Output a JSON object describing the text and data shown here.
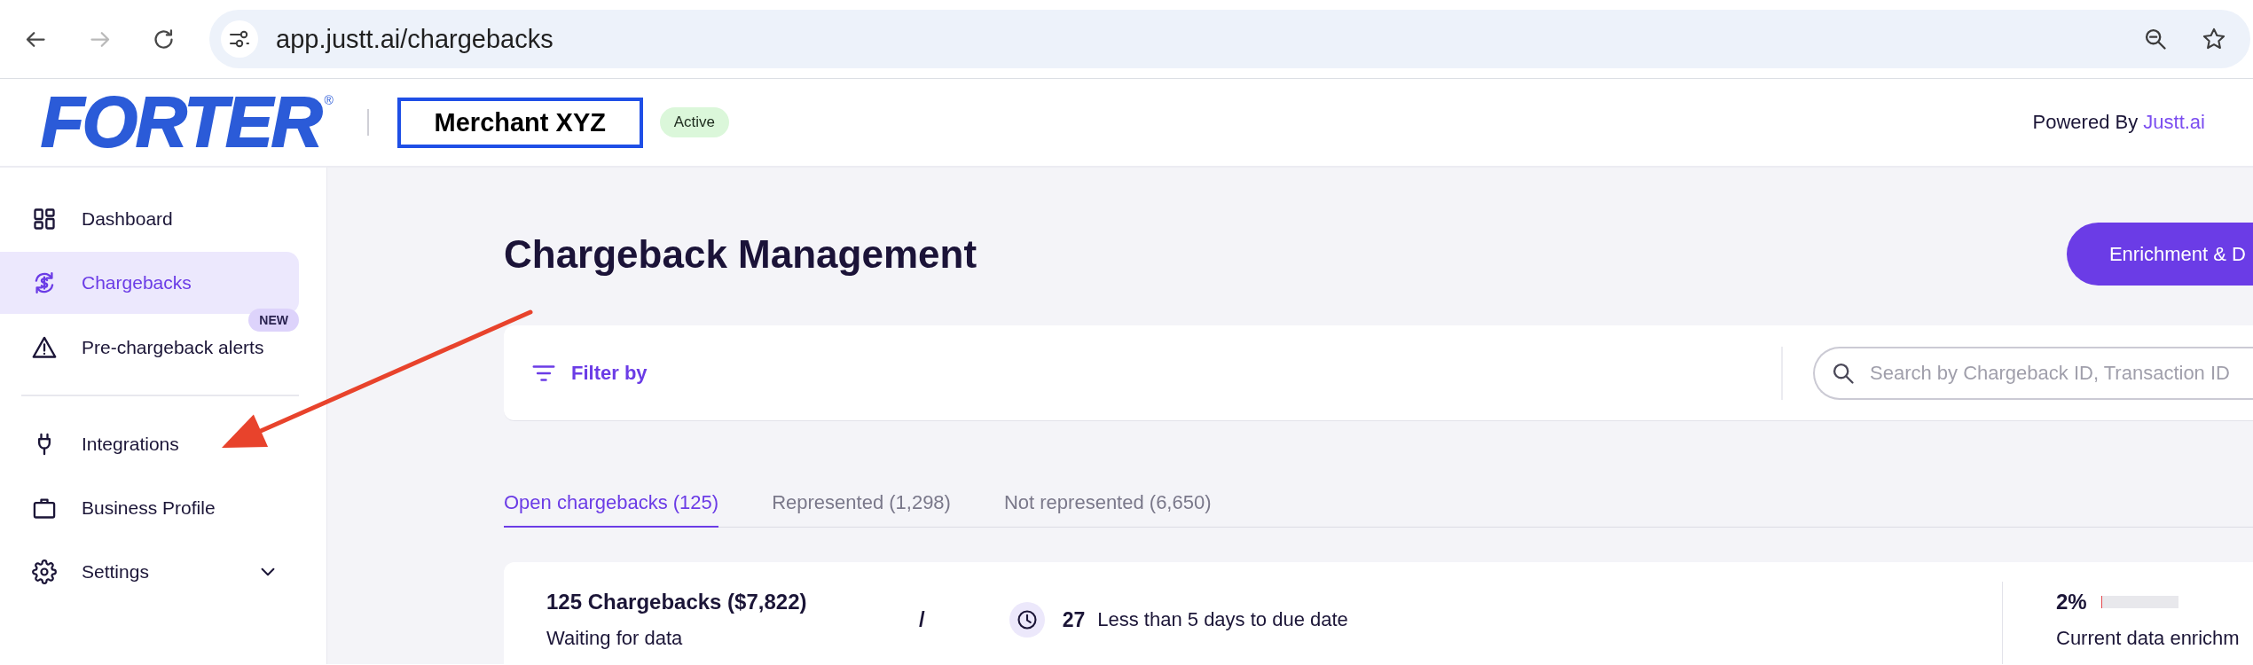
{
  "browser": {
    "nav": [
      {
        "disabled": false
      },
      {
        "disabled": true
      },
      {
        "disabled": false
      }
    ],
    "url": "app.justt.ai/chargebacks"
  },
  "header": {
    "logo": "FORTER",
    "logo_mark": "®",
    "merchant": "Merchant XYZ",
    "status": "Active",
    "powered_by": "Powered By",
    "powered_by_link": "Justt.ai"
  },
  "sidebar": {
    "groups": [
      {
        "items": [
          {
            "label": "Dashboard",
            "selected": false
          },
          {
            "label": "Chargebacks",
            "selected": true
          },
          {
            "label": "Pre-chargeback alerts",
            "selected": false,
            "badge": "NEW"
          }
        ]
      },
      {
        "items": [
          {
            "label": "Integrations",
            "selected": false
          },
          {
            "label": "Business Profile",
            "selected": false
          },
          {
            "label": "Settings",
            "selected": false,
            "expanded": false
          }
        ]
      }
    ]
  },
  "page": {
    "title": "Chargeback Management",
    "action_button": "Enrichment & D"
  },
  "filter_bar": {
    "filter_button": "Filter by",
    "search": {
      "placeholder": "Search by Chargeback ID, Transaction ID"
    }
  },
  "tabs": [
    {
      "label": "Open chargebacks (125)",
      "selected": true
    },
    {
      "label": "Represented (1,298)",
      "selected": false
    },
    {
      "label": "Not represented (6,650)",
      "selected": false
    }
  ],
  "summary": {
    "total": "125 Chargebacks ($7,822)",
    "total_caption": "Waiting for data",
    "separator": "/",
    "due_count": "27",
    "due_caption": "Less than 5 days to due date",
    "enrichment_percent": "2%",
    "enrichment": {
      "level": 0.02
    },
    "enrichment_caption": "Current data enrichm"
  }
}
